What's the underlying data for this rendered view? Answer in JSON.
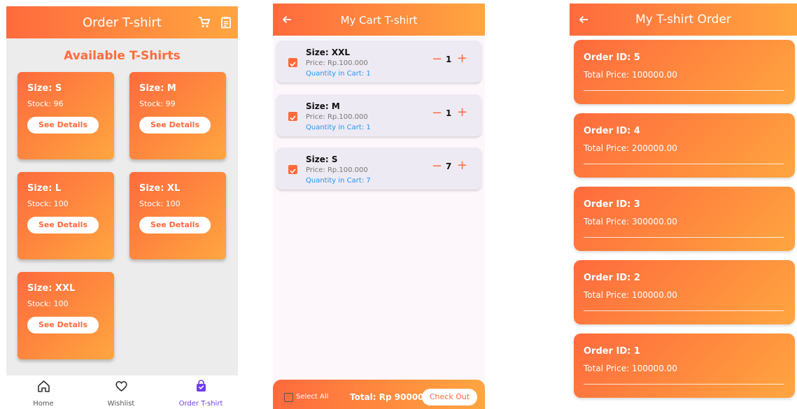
{
  "colors": {
    "accent": "#ff6a3d",
    "accent_light": "#ffa640",
    "link_blue": "#2196f3",
    "nav_active": "#6f3ef5"
  },
  "order_screen": {
    "title": "Order T-shirt",
    "section_title": "Available T-Shirts",
    "cards": [
      {
        "size": "Size: S",
        "stock": "Stock: 96",
        "button": "See Details"
      },
      {
        "size": "Size: M",
        "stock": "Stock: 99",
        "button": "See Details"
      },
      {
        "size": "Size: L",
        "stock": "Stock: 100",
        "button": "See Details"
      },
      {
        "size": "Size: XL",
        "stock": "Stock: 100",
        "button": "See Details"
      },
      {
        "size": "Size: XXL",
        "stock": "Stock: 100",
        "button": "See Details"
      }
    ],
    "nav": [
      {
        "label": "Home",
        "icon": "home-icon"
      },
      {
        "label": "Wishlist",
        "icon": "heart-icon"
      },
      {
        "label": "Order T-shirt",
        "icon": "shopping-bag-icon",
        "active": true
      }
    ]
  },
  "cart_screen": {
    "title": "My Cart T-shirt",
    "items": [
      {
        "size": "Size: XXL",
        "price": "Price: Rp.100.000",
        "qty_in_cart": "Quantity in Cart: 1",
        "minus": "−",
        "qty": "1",
        "plus": "+"
      },
      {
        "size": "Size: M",
        "price": "Price: Rp.100.000",
        "qty_in_cart": "Quantity in Cart: 1",
        "minus": "−",
        "qty": "1",
        "plus": "+"
      },
      {
        "size": "Size: S",
        "price": "Price: Rp.100.000",
        "qty_in_cart": "Quantity in Cart: 7",
        "minus": "−",
        "qty": "7",
        "plus": "+"
      }
    ],
    "select_all": "Select All",
    "total": "Total: Rp 900000",
    "checkout": "Check Out"
  },
  "orders_screen": {
    "title": "My T-shirt Order",
    "orders": [
      {
        "id": "Order ID: 5",
        "total": "Total Price: 100000.00"
      },
      {
        "id": "Order ID: 4",
        "total": "Total Price: 200000.00"
      },
      {
        "id": "Order ID: 3",
        "total": "Total Price: 300000.00"
      },
      {
        "id": "Order ID: 2",
        "total": "Total Price: 100000.00"
      },
      {
        "id": "Order ID: 1",
        "total": "Total Price: 100000.00"
      }
    ]
  }
}
